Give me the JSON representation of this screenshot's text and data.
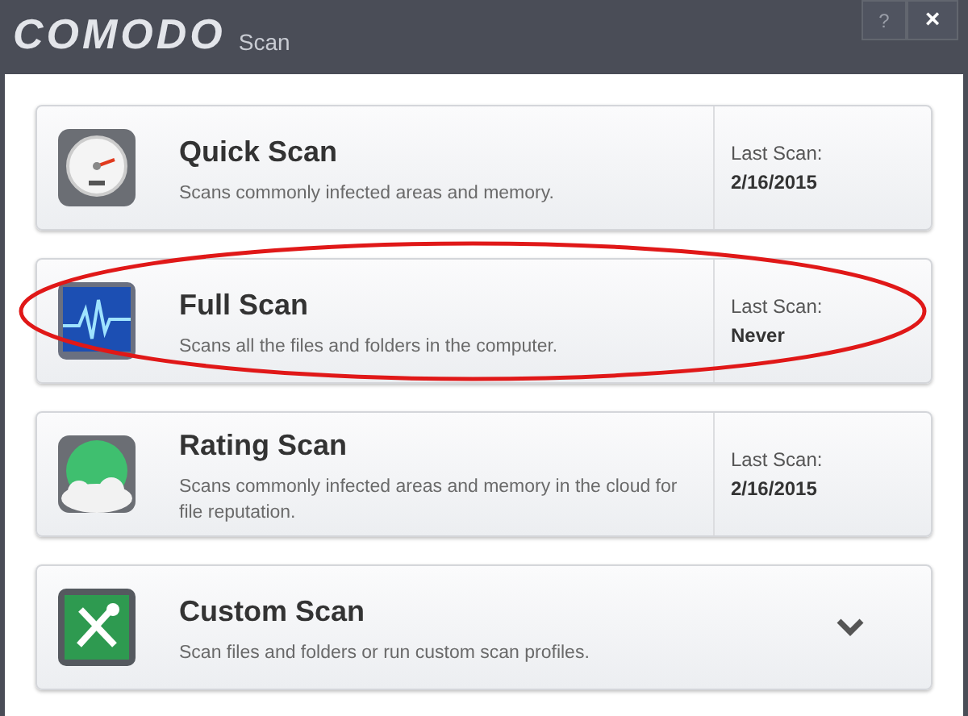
{
  "window": {
    "brand": "COMODO",
    "title": "Scan",
    "buttons": [
      "?",
      "×"
    ]
  },
  "scans": [
    {
      "kind": "dated",
      "name": "Quick Scan",
      "description": "Scans commonly infected areas and memory.",
      "last_scan_label": "Last Scan:",
      "last_scan": "2/16/2015",
      "annotated": false
    },
    {
      "kind": "dated",
      "name": "Full Scan",
      "description": "Scans all the files and folders in the computer.",
      "last_scan_label": "Last Scan:",
      "last_scan": "Never",
      "annotated": true
    },
    {
      "kind": "dated",
      "name": "Rating Scan",
      "description": "Scans commonly infected areas and memory in the cloud for file reputation.",
      "last_scan_label": "Last Scan:",
      "last_scan": "2/16/2015",
      "annotated": false
    },
    {
      "kind": "expandable",
      "name": "Custom Scan",
      "description": "Scan files and folders or run custom scan profiles.",
      "annotated": false
    }
  ]
}
